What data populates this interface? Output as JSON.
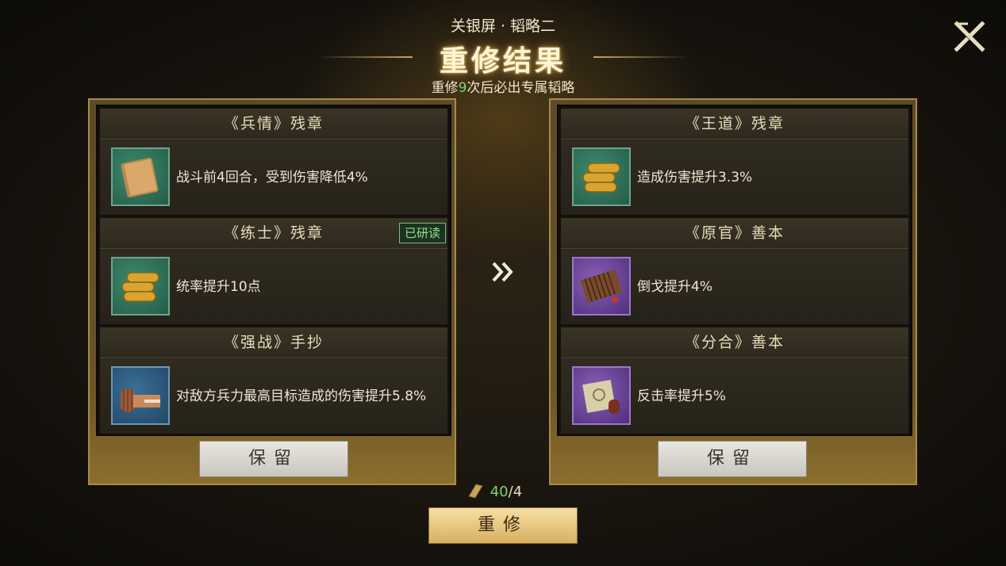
{
  "header": {
    "subtitle": "关银屏 · 韬略二",
    "title": "重修结果",
    "hint_prefix": "重修",
    "hint_count": "9",
    "hint_suffix": "次后必出专属韬略"
  },
  "left_panel": {
    "cards": [
      {
        "name": "《兵情》残章",
        "effect": "战斗前4回合，受到伤害降低4%",
        "icon": "book-icon",
        "rarity": "green"
      },
      {
        "name": "《练士》残章",
        "effect": "统率提升10点",
        "icon": "scroll-bundle-icon",
        "rarity": "green",
        "badge": "已研读"
      },
      {
        "name": "《强战》手抄",
        "effect": "对敌方兵力最高目标造成的伤害提升5.8%",
        "icon": "bamboo-scroll-icon",
        "rarity": "green"
      }
    ],
    "keep_label": "保留"
  },
  "right_panel": {
    "cards": [
      {
        "name": "《王道》残章",
        "effect": "造成伤害提升3.3%",
        "icon": "scroll-bundle-icon",
        "rarity": "green"
      },
      {
        "name": "《原官》善本",
        "effect": "倒戈提升4%",
        "icon": "bamboo-book-icon",
        "rarity": "purple"
      },
      {
        "name": "《分合》善本",
        "effect": "反击率提升5%",
        "icon": "silk-scroll-icon",
        "rarity": "purple"
      }
    ],
    "keep_label": "保留"
  },
  "cost": {
    "have": "40",
    "need": "/4",
    "icon": "scroll-token-icon"
  },
  "redo_label": "重修",
  "colors": {
    "accent_gold": "#c9a45e",
    "highlight_green": "#7fd36a",
    "purple_rarity": "#8a5fb8"
  }
}
